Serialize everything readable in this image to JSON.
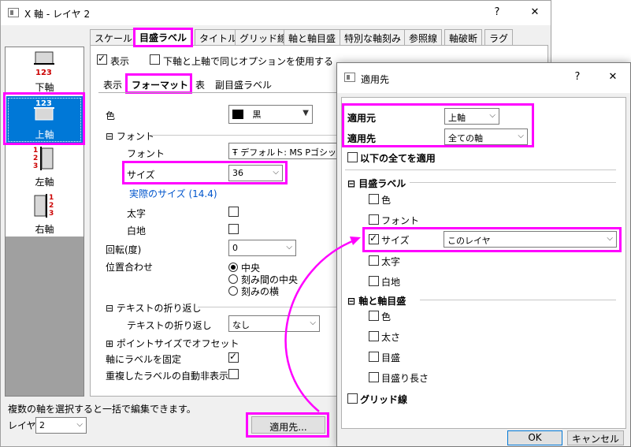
{
  "main": {
    "title": "X 軸 - レイヤ 2",
    "help": "?",
    "close": "✕",
    "tabs": [
      "スケール",
      "目盛ラベル",
      "タイトル",
      "グリッド線",
      "軸と軸目盛",
      "特別な軸刻み",
      "参照線",
      "軸破断",
      "ラグ"
    ],
    "layers": [
      {
        "label": "下軸",
        "icon_text": "123"
      },
      {
        "label": "上軸",
        "icon_text": "123"
      },
      {
        "label": "左軸",
        "icon_text": "123"
      },
      {
        "label": "右軸",
        "icon_text": "123"
      }
    ],
    "show_label": "表示",
    "same_option_label": "下軸と上軸で同じオプションを使用する",
    "subtabs": [
      "表示",
      "フォーマット",
      "表",
      "副目盛ラベル"
    ],
    "color_label": "色",
    "color_value": "黒",
    "font_section": "フォント",
    "font_label": "フォント",
    "font_value": "デフォルト: MS Pゴシック",
    "size_label": "サイズ",
    "size_value": "36",
    "actual_size": "実際のサイズ (14.4)",
    "bold_label": "太字",
    "white_bg_label": "白地",
    "rotate_label": "回転(度)",
    "rotate_value": "0",
    "align_label": "位置合わせ",
    "align_options": [
      "中央",
      "刻み間の中央",
      "刻みの横"
    ],
    "wrap_section": "テキストの折り返し",
    "wrap_label": "テキストの折り返し",
    "wrap_value": "なし",
    "point_size_offset": "ポイントサイズでオフセット",
    "fix_label": "軸にラベルを固定",
    "auto_hide_label": "重複したラベルの自動非表示",
    "hint": "複数の軸を選択すると一括で編集できます。",
    "layer_label": "レイヤ",
    "layer_value": "2",
    "apply_button": "適用先..."
  },
  "apply": {
    "title": "適用先",
    "help": "?",
    "close": "✕",
    "from_label": "適用元",
    "from_value": "上軸",
    "to_label": "適用先",
    "to_value": "全ての軸",
    "apply_all": "以下の全てを適用",
    "tick_label_section": "目盛ラベル",
    "tick_items": [
      "色",
      "フォント",
      "サイズ",
      "太字",
      "白地"
    ],
    "size_target": "このレイヤ",
    "axis_section": "軸と軸目盛",
    "axis_items": [
      "色",
      "太さ",
      "目盛",
      "目盛り長さ"
    ],
    "grid_label": "グリッド線",
    "ok": "OK",
    "cancel": "キャンセル"
  },
  "colors": {
    "accent": "#ff00ff",
    "selection": "#0078d7",
    "tick_red": "#cc0000"
  }
}
